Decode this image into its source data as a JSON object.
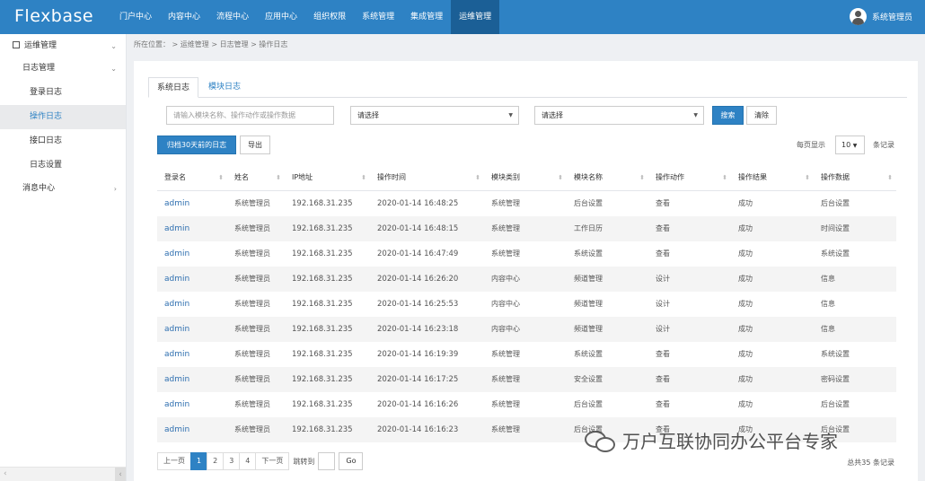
{
  "app": {
    "logo": "Flexbase",
    "user_name": "系统管理员"
  },
  "nav": {
    "items": [
      {
        "label": "门户中心",
        "active": false
      },
      {
        "label": "内容中心",
        "active": false
      },
      {
        "label": "流程中心",
        "active": false
      },
      {
        "label": "应用中心",
        "active": false
      },
      {
        "label": "组织权限",
        "active": false
      },
      {
        "label": "系统管理",
        "active": false
      },
      {
        "label": "集成管理",
        "active": false
      },
      {
        "label": "运维管理",
        "active": true
      }
    ]
  },
  "sidebar": {
    "section": "运维管理",
    "group": "日志管理",
    "items": [
      "登录日志",
      "操作日志",
      "接口日志",
      "日志设置"
    ],
    "active_item": "操作日志",
    "other": "消息中心"
  },
  "breadcrumb": "所在位置：  > 运维管理 > 日志管理 > 操作日志",
  "tabs": [
    "系统日志",
    "模块日志"
  ],
  "filters": {
    "keyword_placeholder": "请输入模块名称、操作动作或操作数据",
    "select1": "请选择",
    "select2": "请选择",
    "search_label": "搜索",
    "clear_label": "清除"
  },
  "actions": {
    "archive_label": "归档30天前的日志",
    "export_label": "导出"
  },
  "page_size": {
    "label": "每页显示",
    "value": "10",
    "unit": "条记录"
  },
  "table": {
    "columns": [
      "登录名",
      "姓名",
      "IP地址",
      "操作时间",
      "模块类别",
      "模块名称",
      "操作动作",
      "操作结果",
      "操作数据"
    ],
    "rows": [
      [
        "admin",
        "系统管理员",
        "192.168.31.235",
        "2020-01-14 16:48:25",
        "系统管理",
        "后台设置",
        "查看",
        "成功",
        "后台设置"
      ],
      [
        "admin",
        "系统管理员",
        "192.168.31.235",
        "2020-01-14 16:48:15",
        "系统管理",
        "工作日历",
        "查看",
        "成功",
        "时间设置"
      ],
      [
        "admin",
        "系统管理员",
        "192.168.31.235",
        "2020-01-14 16:47:49",
        "系统管理",
        "系统设置",
        "查看",
        "成功",
        "系统设置"
      ],
      [
        "admin",
        "系统管理员",
        "192.168.31.235",
        "2020-01-14 16:26:20",
        "内容中心",
        "频道管理",
        "设计",
        "成功",
        "信息"
      ],
      [
        "admin",
        "系统管理员",
        "192.168.31.235",
        "2020-01-14 16:25:53",
        "内容中心",
        "频道管理",
        "设计",
        "成功",
        "信息"
      ],
      [
        "admin",
        "系统管理员",
        "192.168.31.235",
        "2020-01-14 16:23:18",
        "内容中心",
        "频道管理",
        "设计",
        "成功",
        "信息"
      ],
      [
        "admin",
        "系统管理员",
        "192.168.31.235",
        "2020-01-14 16:19:39",
        "系统管理",
        "系统设置",
        "查看",
        "成功",
        "系统设置"
      ],
      [
        "admin",
        "系统管理员",
        "192.168.31.235",
        "2020-01-14 16:17:25",
        "系统管理",
        "安全设置",
        "查看",
        "成功",
        "密码设置"
      ],
      [
        "admin",
        "系统管理员",
        "192.168.31.235",
        "2020-01-14 16:16:26",
        "系统管理",
        "后台设置",
        "查看",
        "成功",
        "后台设置"
      ],
      [
        "admin",
        "系统管理员",
        "192.168.31.235",
        "2020-01-14 16:16:23",
        "系统管理",
        "后台设置",
        "查看",
        "成功",
        "后台设置"
      ]
    ]
  },
  "pager": {
    "prev": "上一页",
    "pages": [
      "1",
      "2",
      "3",
      "4"
    ],
    "current": "1",
    "next": "下一页",
    "jump_label": "跳转到",
    "go": "Go",
    "total": "总共35 条记录"
  },
  "watermark": "万户互联协同办公平台专家"
}
